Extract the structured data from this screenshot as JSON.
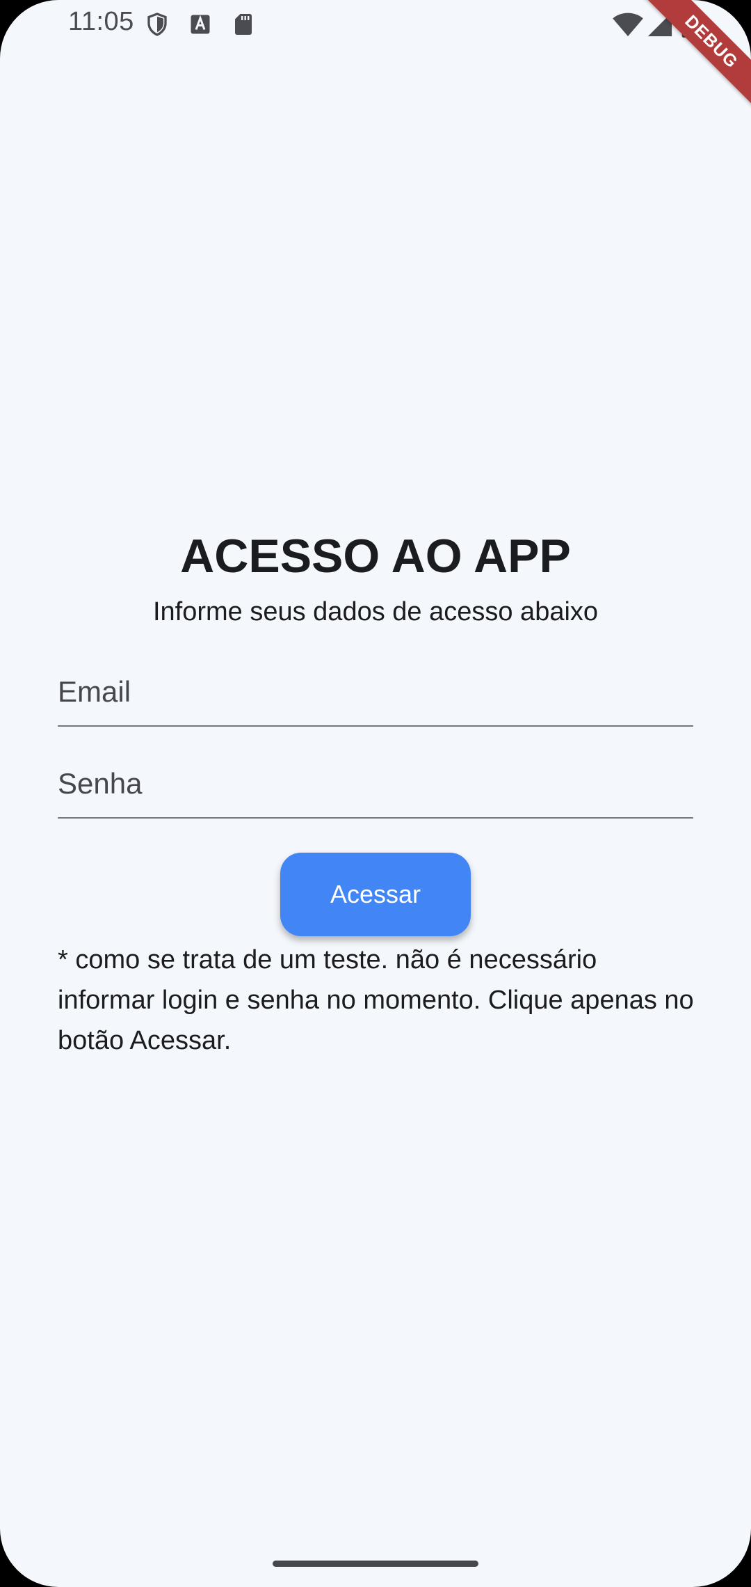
{
  "status_bar": {
    "time": "11:05",
    "icons": [
      "shield-icon",
      "a-icon",
      "sd-card-icon",
      "wifi-icon",
      "signal-icon",
      "battery-icon"
    ]
  },
  "debug_banner": "DEBUG",
  "login": {
    "title": "ACESSO AO APP",
    "subtitle": "Informe seus dados de acesso abaixo",
    "email_placeholder": "Email",
    "email_value": "",
    "password_placeholder": "Senha",
    "password_value": "",
    "submit_label": "Acessar",
    "note": "* como se trata de um teste. não é necessário informar login e senha no momento. Clique apenas no botão Acessar."
  },
  "colors": {
    "background": "#f4f7fb",
    "button": "#4286f5",
    "debug_ribbon": "#b23c3c",
    "text": "#1b1c1f"
  }
}
